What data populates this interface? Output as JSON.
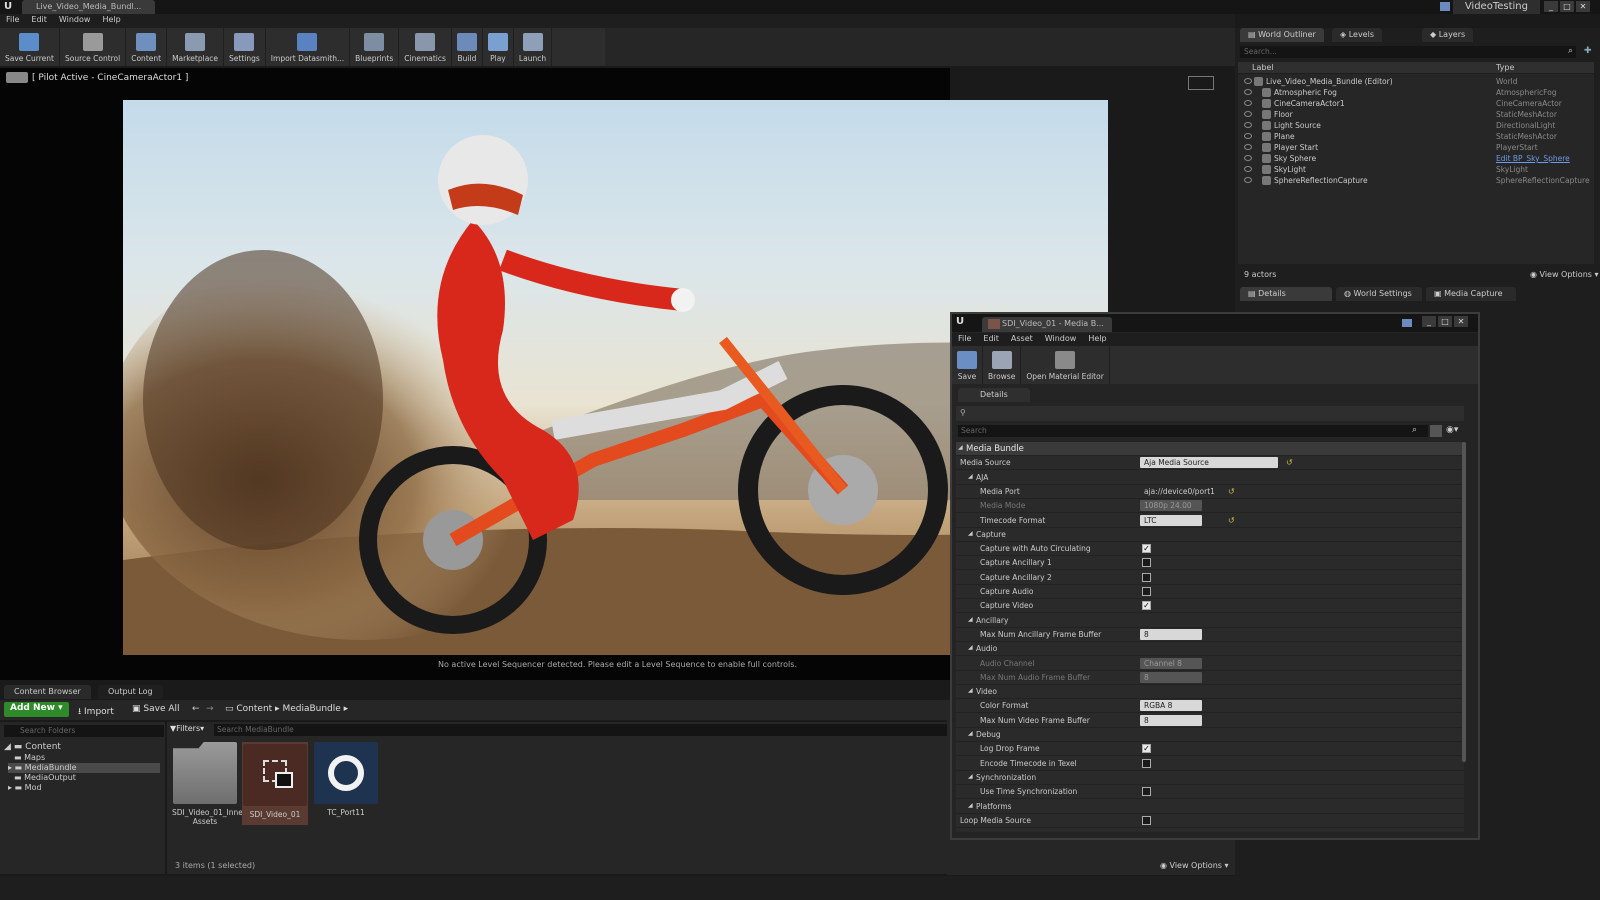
{
  "titlebar": {
    "document_tab": "Live_Video_Media_Bundl...",
    "project_name": "VideoTesting",
    "logo": "U"
  },
  "menu": [
    "File",
    "Edit",
    "Window",
    "Help"
  ],
  "toolbar": [
    {
      "label": "Save Current",
      "icon": "save-icon",
      "color": "#5b8dc9"
    },
    {
      "label": "Source Control",
      "icon": "source-control-icon",
      "color": "#9a9a9a"
    },
    {
      "label": "Content",
      "icon": "content-icon",
      "color": "#6f8fbf"
    },
    {
      "label": "Marketplace",
      "icon": "marketplace-icon",
      "color": "#8a9ab0"
    },
    {
      "label": "Settings",
      "icon": "settings-icon",
      "color": "#8899bb"
    },
    {
      "label": "Import Datasmith...",
      "icon": "datasmith-icon",
      "color": "#5a82c0"
    },
    {
      "label": "Blueprints",
      "icon": "blueprints-icon",
      "color": "#7d8ea3"
    },
    {
      "label": "Cinematics",
      "icon": "cinematics-icon",
      "color": "#8a96ab"
    },
    {
      "label": "Build",
      "icon": "build-icon",
      "color": "#6d8bb8"
    },
    {
      "label": "Play",
      "icon": "play-icon",
      "color": "#7aa0d0"
    },
    {
      "label": "Launch",
      "icon": "launch-icon",
      "color": "#8da0b8"
    }
  ],
  "viewport": {
    "header": "[ Pilot Active - CineCameraActor1 ]",
    "message": "No active Level Sequencer detected. Please edit a Level Sequence to enable full controls."
  },
  "content_browser": {
    "tabs": [
      "Content Browser",
      "Output Log"
    ],
    "add_new": "Add New",
    "import": "Import",
    "save_all": "Save All",
    "path": [
      "Content",
      "MediaBundle"
    ],
    "folder_search_placeholder": "Search Folders",
    "filters": "Filters",
    "asset_search_placeholder": "Search MediaBundle",
    "folders": [
      "Content",
      "Maps",
      "MediaBundle",
      "MediaOutput",
      "Mod"
    ],
    "assets": [
      {
        "name": "SDI_Video_01_Inner Assets",
        "kind": "folder"
      },
      {
        "name": "SDI_Video_01",
        "kind": "media-bundle",
        "selected": true
      },
      {
        "name": "TC_Port11",
        "kind": "timecode"
      }
    ],
    "items_count": "3 items (1 selected)",
    "view_options": "View Options"
  },
  "world_outliner": {
    "tabs": [
      "World Outliner",
      "Levels",
      "Layers"
    ],
    "search_placeholder": "Search...",
    "col_label": "Label",
    "col_type": "Type",
    "rows": [
      {
        "label": "Live_Video_Media_Bundle (Editor)",
        "type": "World"
      },
      {
        "label": "Atmospheric Fog",
        "type": "AtmosphericFog"
      },
      {
        "label": "CineCameraActor1",
        "type": "CineCameraActor"
      },
      {
        "label": "Floor",
        "type": "StaticMeshActor"
      },
      {
        "label": "Light Source",
        "type": "DirectionalLight"
      },
      {
        "label": "Plane",
        "type": "StaticMeshActor"
      },
      {
        "label": "Player Start",
        "type": "PlayerStart"
      },
      {
        "label": "Sky Sphere",
        "type": "Edit BP_Sky_Sphere"
      },
      {
        "label": "SkyLight",
        "type": "SkyLight"
      },
      {
        "label": "SphereReflectionCapture",
        "type": "SphereReflectionCapture"
      }
    ],
    "actors_count": "9 actors",
    "view_options": "View Options"
  },
  "details_tabs": [
    "Details",
    "World Settings",
    "Media Capture"
  ],
  "media_window": {
    "tab_title": "SDI_Video_01 - Media B...",
    "menu": [
      "File",
      "Edit",
      "Asset",
      "Window",
      "Help"
    ],
    "toolbar": [
      {
        "label": "Save",
        "icon": "save-icon"
      },
      {
        "label": "Browse",
        "icon": "browse-icon"
      },
      {
        "label": "Open Material Editor",
        "icon": "material-editor-icon"
      }
    ],
    "details_tab": "Details",
    "search_placeholder": "Search",
    "properties": [
      {
        "kind": "cat",
        "label": "Media Bundle",
        "indent": 0
      },
      {
        "kind": "dropdown",
        "label": "Media Source",
        "value": "Aja Media Source",
        "indent": 0,
        "reset": true
      },
      {
        "kind": "sub",
        "label": "AJA",
        "indent": 1
      },
      {
        "kind": "dropdown",
        "label": "Media Port",
        "value": "aja://device0/port1",
        "indent": 2,
        "reset": true
      },
      {
        "kind": "dropdown-dim",
        "label": "Media Mode",
        "value": "1080p 24.00",
        "indent": 2,
        "dim": true
      },
      {
        "kind": "dropdown",
        "label": "Timecode Format",
        "value": "LTC",
        "indent": 2,
        "reset": true
      },
      {
        "kind": "sub",
        "label": "Capture",
        "indent": 1
      },
      {
        "kind": "check",
        "label": "Capture with Auto Circulating",
        "value": true,
        "indent": 2
      },
      {
        "kind": "check",
        "label": "Capture Ancillary 1",
        "value": false,
        "indent": 2
      },
      {
        "kind": "check",
        "label": "Capture Ancillary 2",
        "value": false,
        "indent": 2
      },
      {
        "kind": "check",
        "label": "Capture Audio",
        "value": false,
        "indent": 2
      },
      {
        "kind": "check",
        "label": "Capture Video",
        "value": true,
        "indent": 2
      },
      {
        "kind": "sub",
        "label": "Ancillary",
        "indent": 1
      },
      {
        "kind": "number",
        "label": "Max Num Ancillary Frame Buffer",
        "value": "8",
        "indent": 2
      },
      {
        "kind": "sub",
        "label": "Audio",
        "indent": 1
      },
      {
        "kind": "dropdown-dim",
        "label": "Audio Channel",
        "value": "Channel 8",
        "indent": 2,
        "dim": true
      },
      {
        "kind": "number-dim",
        "label": "Max Num Audio Frame Buffer",
        "value": "8",
        "indent": 2,
        "dim": true
      },
      {
        "kind": "sub",
        "label": "Video",
        "indent": 1
      },
      {
        "kind": "dropdown",
        "label": "Color Format",
        "value": "RGBA 8",
        "indent": 2
      },
      {
        "kind": "number",
        "label": "Max Num Video Frame Buffer",
        "value": "8",
        "indent": 2
      },
      {
        "kind": "sub",
        "label": "Debug",
        "indent": 1
      },
      {
        "kind": "check",
        "label": "Log Drop Frame",
        "value": true,
        "indent": 2
      },
      {
        "kind": "check",
        "label": "Encode Timecode in Texel",
        "value": false,
        "indent": 2
      },
      {
        "kind": "sub",
        "label": "Synchronization",
        "indent": 1
      },
      {
        "kind": "check",
        "label": "Use Time Synchronization",
        "value": false,
        "indent": 2
      },
      {
        "kind": "sub",
        "label": "Platforms",
        "indent": 1
      },
      {
        "kind": "check",
        "label": "Loop Media Source",
        "value": false,
        "indent": 0
      }
    ]
  },
  "colors": {
    "accent": "#2f8a2a",
    "selected_asset": "#5b3a32",
    "link": "#6a9ae8"
  }
}
